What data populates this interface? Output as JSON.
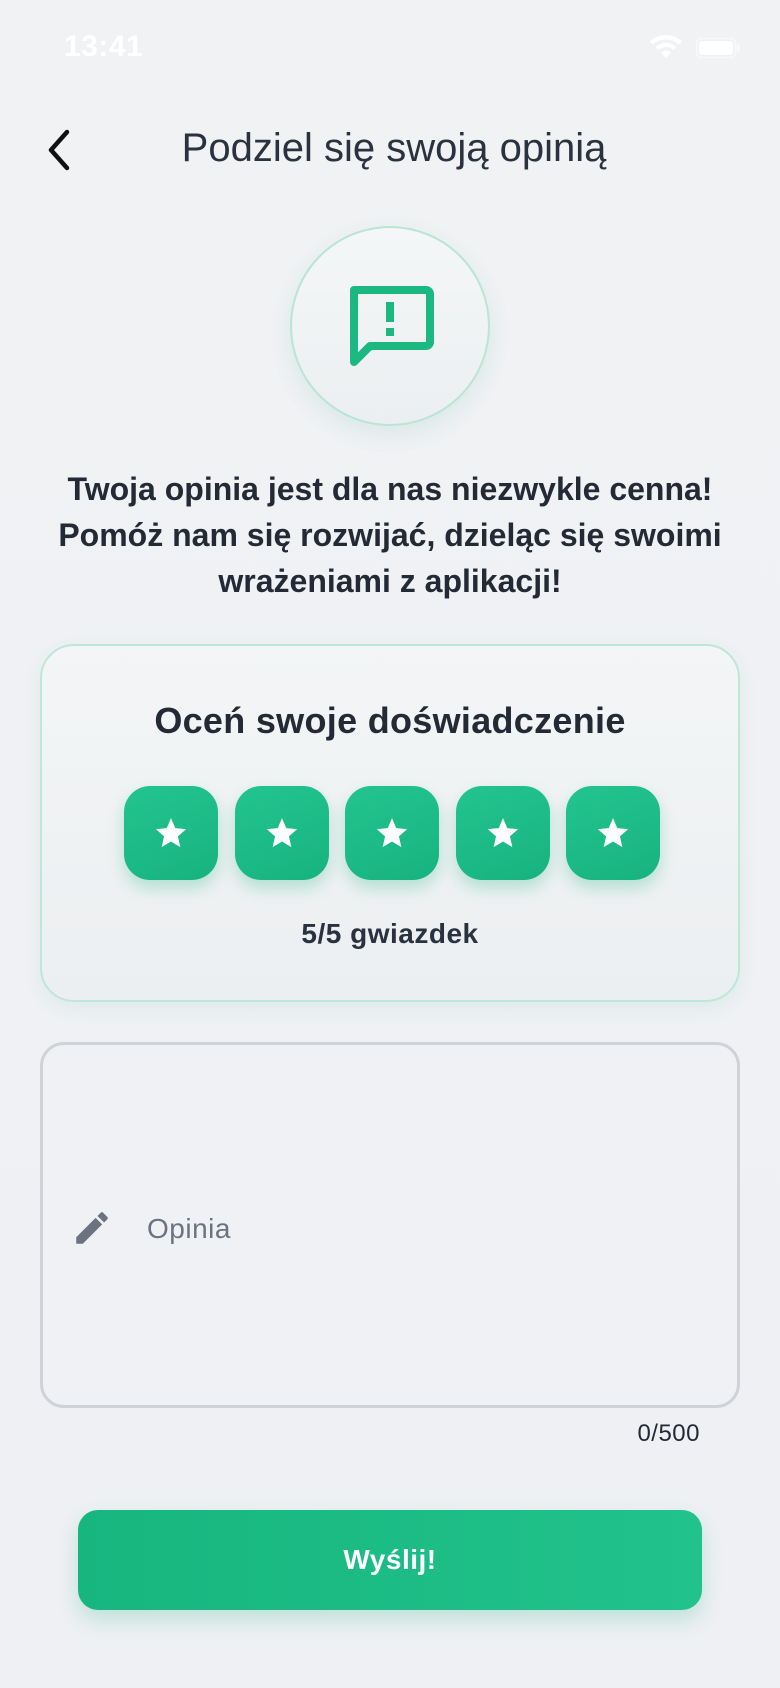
{
  "status_bar": {
    "time": "13:41",
    "wifi_icon": "wifi-icon",
    "battery_icon": "battery-icon"
  },
  "header": {
    "back_icon": "chevron-left-icon",
    "title": "Podziel się swoją opinią"
  },
  "hero": {
    "icon": "feedback-alert-icon",
    "accent_color": "#1bb882"
  },
  "intro": {
    "text": "Twoja opinia jest dla nas niezwykle cenna! Pomóż nam się rozwijać, dzieląc się swoimi wrażeniami z aplikacji!"
  },
  "rating": {
    "title": "Oceń swoje doświadczenie",
    "stars": [
      {
        "icon": "star-icon",
        "selected": true
      },
      {
        "icon": "star-icon",
        "selected": true
      },
      {
        "icon": "star-icon",
        "selected": true
      },
      {
        "icon": "star-icon",
        "selected": true
      },
      {
        "icon": "star-icon",
        "selected": true
      }
    ],
    "value": 5,
    "max": 5,
    "count_label": "5/5 gwiazdek",
    "star_color": "#1bb882"
  },
  "opinion": {
    "icon": "pencil-icon",
    "placeholder": "Opinia",
    "value": "",
    "counter": "0/500"
  },
  "submit": {
    "label": "Wyślij!",
    "color": "#1bb882"
  }
}
